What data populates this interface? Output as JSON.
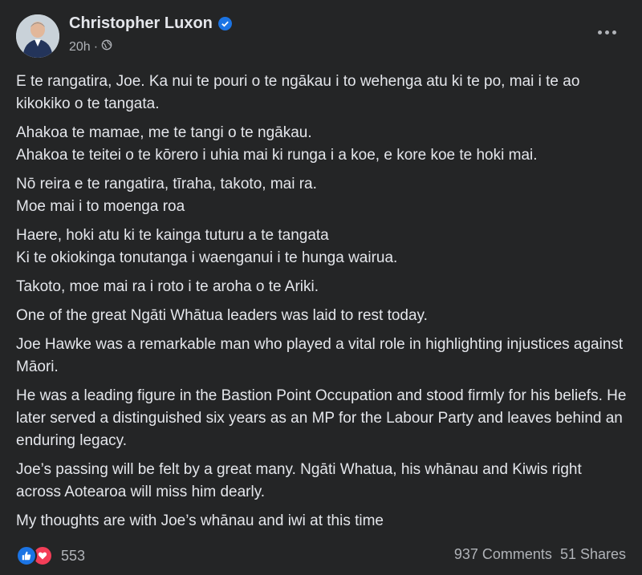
{
  "post": {
    "author": "Christopher Luxon",
    "time": "20h",
    "paragraphs": [
      [
        "E te rangatira, Joe. Ka nui te pouri o te ngākau i to wehenga atu ki te po, mai i te ao kikokiko o te tangata."
      ],
      [
        "Ahakoa te mamae, me te tangi o te ngākau.",
        "Ahakoa te teitei o te kōrero i uhia mai ki runga i a koe, e kore koe te hoki mai."
      ],
      [
        "Nō reira e te rangatira, tīraha, takoto, mai ra.",
        "Moe mai i to moenga roa"
      ],
      [
        "Haere, hoki atu ki te kainga tuturu a te tangata",
        "Ki te okiokinga tonutanga i waenganui i te hunga wairua."
      ],
      [
        "Takoto, moe mai ra i roto i te aroha o te Ariki."
      ],
      [
        "One of the great Ngāti Whātua leaders was laid to rest today."
      ],
      [
        "Joe Hawke was a remarkable man who played a vital role in highlighting injustices against Māori."
      ],
      [
        "He was a leading figure in the Bastion Point Occupation and stood firmly for his beliefs. He later served a distinguished six years as an MP for the Labour Party and leaves behind an enduring legacy."
      ],
      [
        "Joe’s passing will be felt by a great many. Ngāti Whatua, his whānau and Kiwis right across Aotearoa will miss him dearly."
      ],
      [
        "My thoughts are with Joe’s whānau and iwi at this time"
      ]
    ],
    "reactions_count": "553",
    "comments": "937 Comments",
    "shares": "51 Shares"
  },
  "icons": {
    "verified": "verified-badge-icon",
    "audience": "globe-icon",
    "menu": "more-options-icon",
    "like": "like-reaction-icon",
    "love": "love-reaction-icon"
  },
  "colors": {
    "background": "#242526",
    "text": "#e4e6eb",
    "secondary": "#b0b3b8",
    "accent": "#1b74e4",
    "love": "#f33e58"
  }
}
